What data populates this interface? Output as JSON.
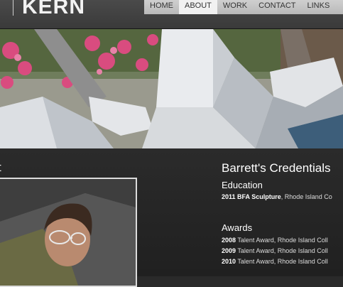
{
  "brand": {
    "logo_text": "KERN"
  },
  "nav": {
    "items": [
      {
        "label": "HOME"
      },
      {
        "label": "ABOUT"
      },
      {
        "label": "WORK"
      },
      {
        "label": "CONTACT"
      },
      {
        "label": "LINKS"
      }
    ],
    "active": "ABOUT"
  },
  "hero": {
    "description_icon": "sculpture-photo"
  },
  "left": {
    "heading": "t"
  },
  "credentials": {
    "title": "Barrett's Credentials",
    "education": {
      "heading": "Education",
      "entries": [
        {
          "year_degree": "2011 BFA Sculpture",
          "rest": ", Rhode Island Co"
        }
      ]
    },
    "awards": {
      "heading": "Awards",
      "entries": [
        {
          "year": "2008",
          "rest": " Talent Award, Rhode Island Coll"
        },
        {
          "year": "2009",
          "rest": " Talent Award, Rhode Island Coll"
        },
        {
          "year": "2010",
          "rest": " Talent Award, Rhode Island Coll"
        }
      ]
    }
  },
  "colors": {
    "page_bg": "#2a2a2a",
    "nav_bg": "#c6c6c6",
    "nav_active": "#f1f1f1"
  }
}
